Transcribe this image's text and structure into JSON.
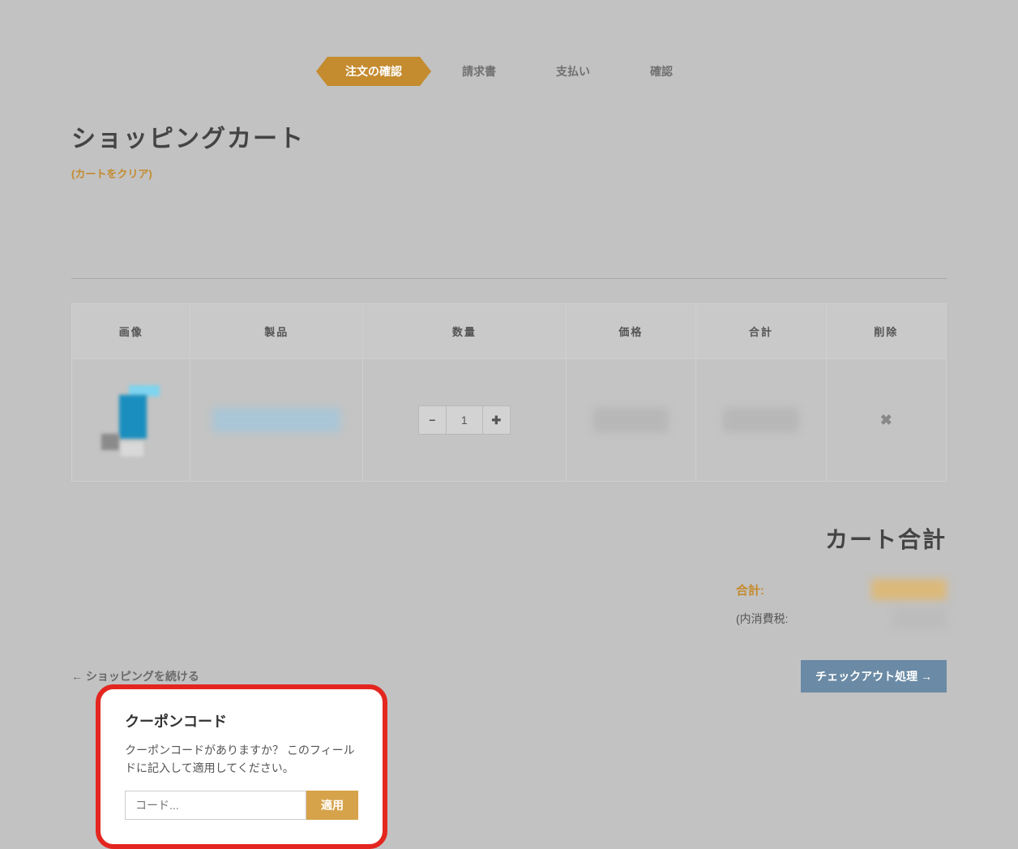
{
  "steps": {
    "review": "注文の確認",
    "billing": "請求書",
    "payment": "支払い",
    "confirm": "確認"
  },
  "page": {
    "title": "ショッピングカート",
    "clear_cart": "(カートをクリア)"
  },
  "table": {
    "headers": {
      "image": "画像",
      "product": "製品",
      "quantity": "数量",
      "price": "価格",
      "total": "合計",
      "remove": "削除"
    },
    "rows": [
      {
        "product_name": "████ ████ ███",
        "quantity": "1",
        "price": "████",
        "total": "████"
      }
    ]
  },
  "totals": {
    "heading": "カート合計",
    "total_label": "合計:",
    "total_value": "████",
    "tax_label": "(内消費税:",
    "tax_value": "███"
  },
  "actions": {
    "continue": "ショッピングを続ける",
    "checkout": "チェックアウト処理"
  },
  "coupon": {
    "title": "クーポンコード",
    "desc": "クーポンコードがありますか？ このフィールドに記入して適用してください。",
    "placeholder": "コード...",
    "apply": "適用"
  }
}
